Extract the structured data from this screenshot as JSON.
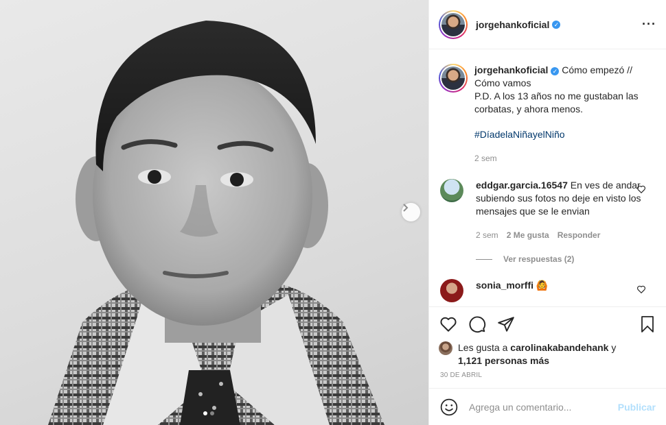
{
  "post": {
    "username": "jorgehankoficial",
    "verified_icon": "verified-badge-icon",
    "more_icon": "more-options-icon",
    "image_description_icon": "photo",
    "carousel": {
      "total": 2,
      "current": 1
    }
  },
  "caption": {
    "username": "jorgehankoficial",
    "text_line1": "Cómo empezó //",
    "text_line2": "Cómo vamos",
    "text_line3": "P.D. A los 13 años no me gustaban las corbatas, y ahora menos.",
    "hashtag": "#DíadelaNiñayelNiño",
    "time": "2 sem"
  },
  "comments": [
    {
      "username": "eddgar.garcia.16547",
      "text": "En ves de andar subiendo sus fotos no deje en visto los mensajes que se le envian",
      "time": "2 sem",
      "likes": "2 Me gusta",
      "reply": "Responder",
      "view_replies": "Ver respuestas (2)"
    },
    {
      "username": "sonia_morffi",
      "text": "🙆"
    }
  ],
  "likes": {
    "prefix": "Les gusta a",
    "user": "carolinakabandehank",
    "joiner": "y",
    "others": "1,121 personas más"
  },
  "date": "30 DE ABRIL",
  "add_comment": {
    "placeholder": "Agrega un comentario...",
    "publish": "Publicar"
  },
  "colors": {
    "accent_blue": "#0095f6",
    "publish_disabled": "#b2dffc",
    "hashtag": "#00376b",
    "muted": "#8e8e8e"
  }
}
